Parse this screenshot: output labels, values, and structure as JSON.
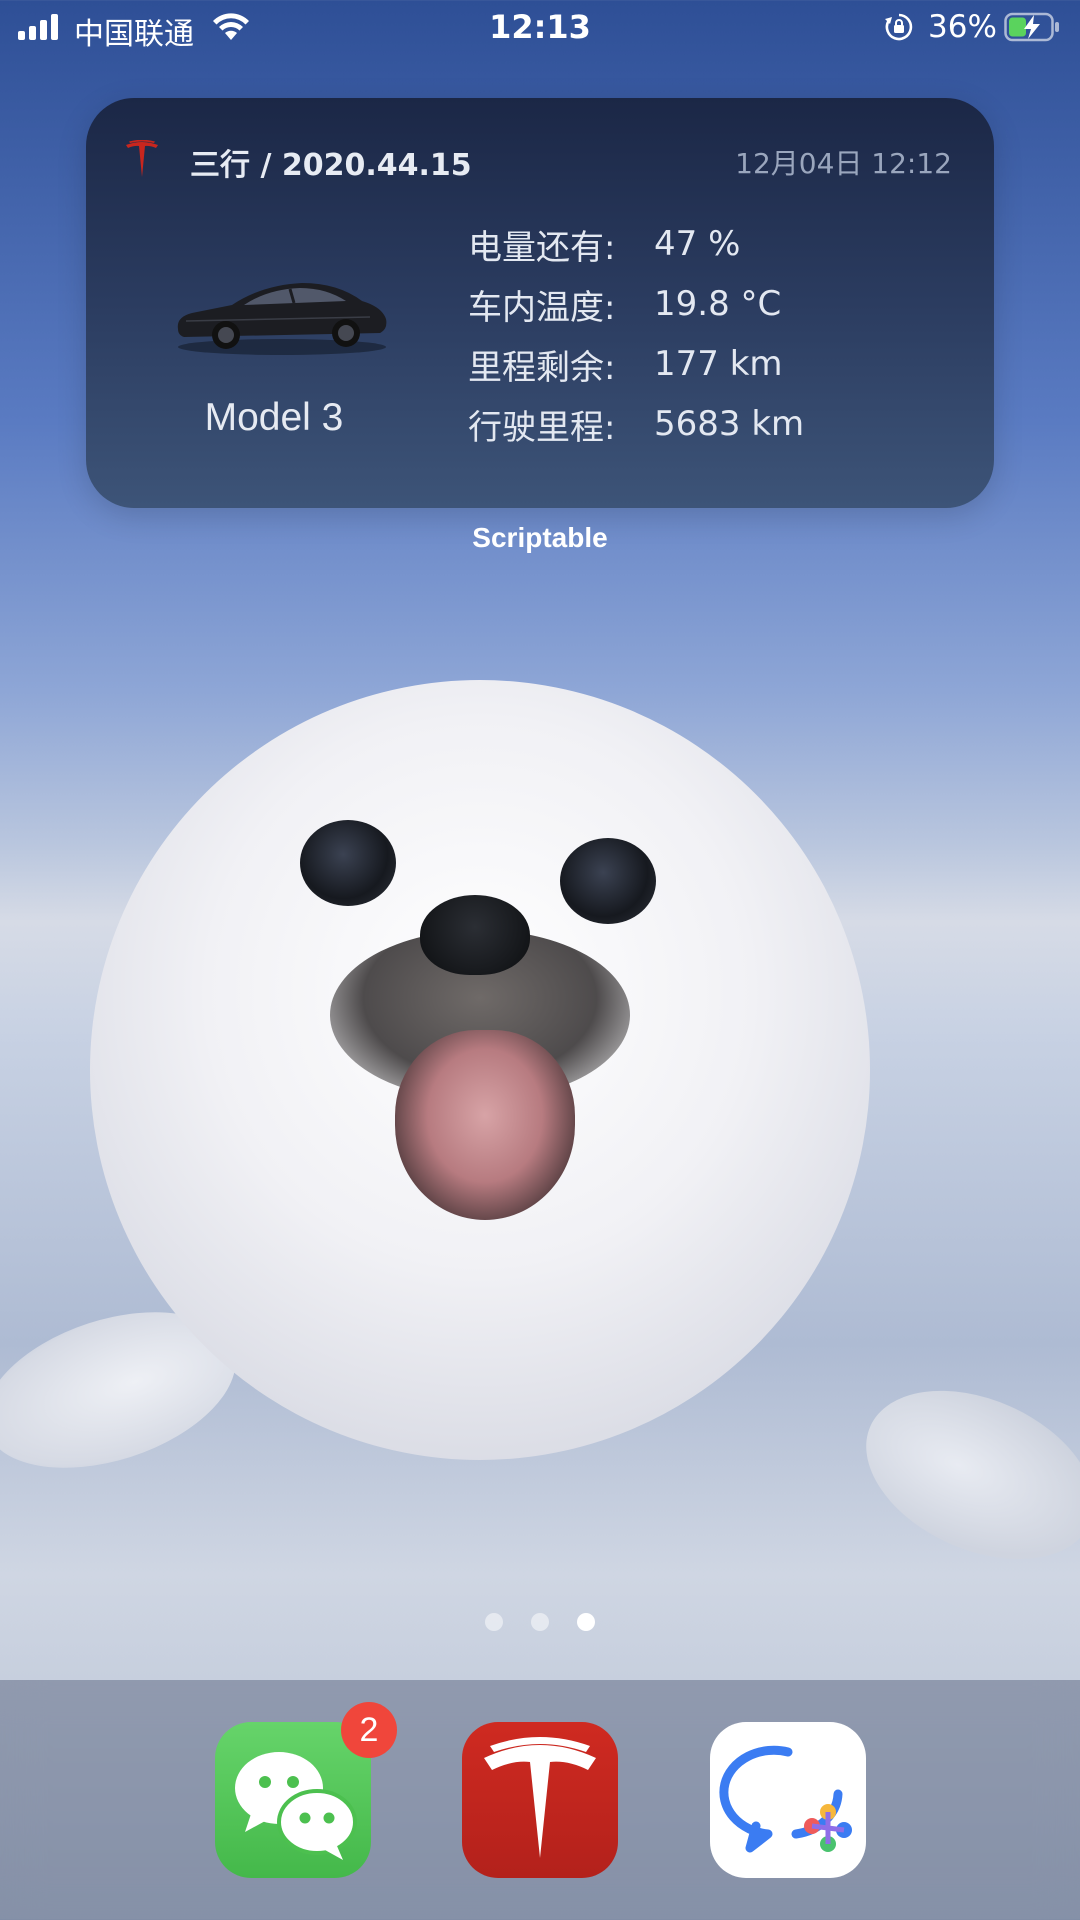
{
  "status_bar": {
    "carrier": "中国联通",
    "time": "12:13",
    "battery_percent": "36%"
  },
  "widget": {
    "title": "三行 / 2020.44.15",
    "timestamp": "12月04日 12:12",
    "model": "Model 3",
    "stats": [
      {
        "label": "电量还有:",
        "value": "47 %"
      },
      {
        "label": "车内温度:",
        "value": "19.8 °C"
      },
      {
        "label": "里程剩余:",
        "value": "177 km"
      },
      {
        "label": "行驶里程:",
        "value": "5683 km"
      }
    ],
    "caption": "Scriptable"
  },
  "page_indicator": {
    "pages": 3,
    "current": 3
  },
  "dock": {
    "apps": [
      {
        "name": "wechat",
        "badge": "2"
      },
      {
        "name": "tesla",
        "badge": ""
      },
      {
        "name": "chat",
        "badge": ""
      }
    ]
  },
  "colors": {
    "tesla_red": "#c8261e",
    "wechat_green": "#4cc04f",
    "badge_red": "#f0463b",
    "widget_bg": "#2b3c60"
  },
  "icons": [
    "signal-icon",
    "wifi-icon",
    "rotation-lock-icon",
    "battery-charging-icon",
    "tesla-logo-icon",
    "car-image",
    "wechat-icon",
    "tesla-app-icon",
    "chat-app-icon"
  ]
}
